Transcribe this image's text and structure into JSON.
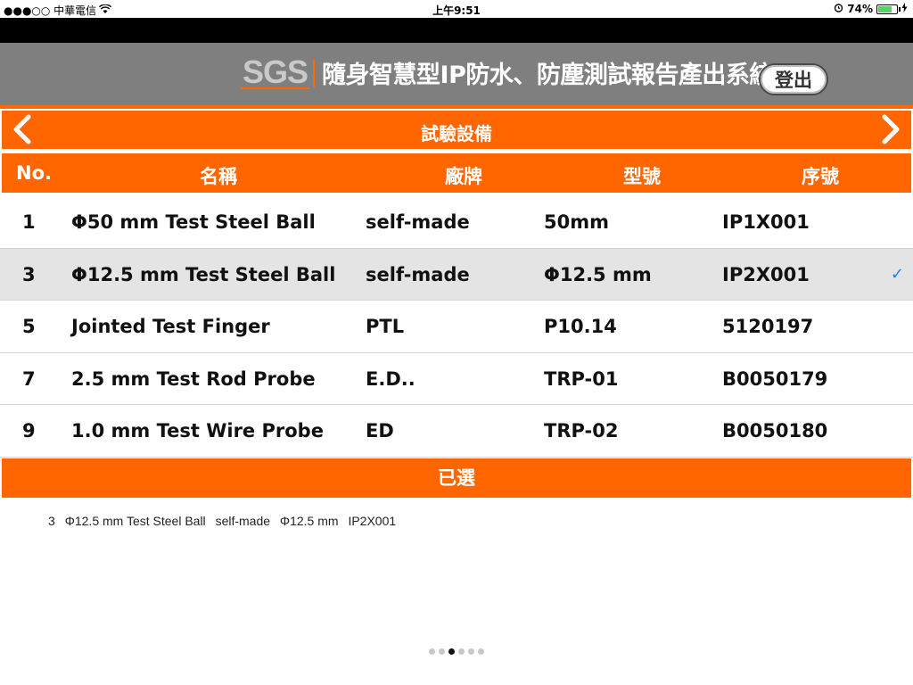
{
  "status_bar": {
    "carrier": "●●●○○ 中華電信",
    "wifi_icon": "wifi-icon",
    "time": "上午9:51",
    "alarm_icon": "alarm-icon",
    "battery_percent": "74%",
    "battery_level": 0.74,
    "charging_icon": "charging-bolt-icon"
  },
  "header": {
    "logo": "SGS",
    "title": "隨身智慧型IP防水、防塵測試報告產出系統",
    "logout_label": "登出",
    "colors": {
      "header_bg": "#7f7f7f",
      "accent": "#ff6600"
    }
  },
  "nav": {
    "title": "試驗設備",
    "prev_icon": "chevron-left-icon",
    "next_icon": "chevron-right-icon"
  },
  "table": {
    "columns": [
      "No.",
      "名稱",
      "廠牌",
      "型號",
      "序號"
    ],
    "rows": [
      {
        "no": "1",
        "name": "Φ50 mm Test Steel Ball",
        "brand": "self-made",
        "model": "50mm",
        "serial": "IP1X001",
        "selected": false
      },
      {
        "no": "3",
        "name": "Φ12.5 mm Test Steel Ball",
        "brand": "self-made",
        "model": "Φ12.5 mm",
        "serial": "IP2X001",
        "selected": true
      },
      {
        "no": "5",
        "name": "Jointed Test Finger",
        "brand": "PTL",
        "model": "P10.14",
        "serial": "5120197",
        "selected": false
      },
      {
        "no": "7",
        "name": "2.5 mm Test Rod Probe",
        "brand": "E.D..",
        "model": "TRP-01",
        "serial": "B0050179",
        "selected": false
      },
      {
        "no": "9",
        "name": "1.0 mm Test Wire Probe",
        "brand": "ED",
        "model": "TRP-02",
        "serial": "B0050180",
        "selected": false
      }
    ],
    "check_mark": "✓"
  },
  "selected_section": {
    "title": "已選",
    "items": [
      {
        "no": "3",
        "name": "Φ12.5 mm Test Steel Ball",
        "brand": "self-made",
        "model": "Φ12.5 mm",
        "serial": "IP2X001"
      }
    ]
  },
  "pager": {
    "total": 6,
    "current": 3
  }
}
